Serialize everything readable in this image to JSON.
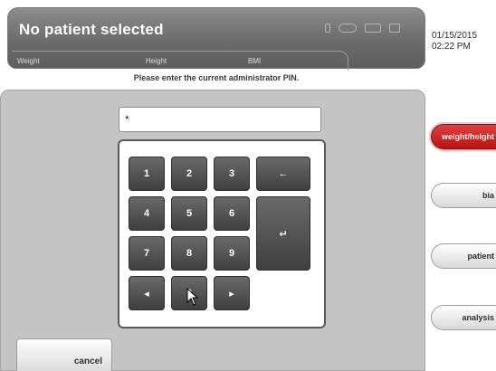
{
  "header": {
    "title": "No patient selected",
    "stats": [
      {
        "label": "Weight"
      },
      {
        "label": "Height"
      },
      {
        "label": "BMI"
      }
    ],
    "status_icons": [
      "battery-icon",
      "scale-icon",
      "transfer-icon",
      "network-icon"
    ]
  },
  "datetime": {
    "date": "01/15/2015",
    "time": "02:22 PM"
  },
  "prompt": "Please enter the current administrator PIN.",
  "pin_field": {
    "value": "*"
  },
  "keypad": {
    "keys": {
      "k1": "1",
      "k2": "2",
      "k3": "3",
      "k4": "4",
      "k5": "5",
      "k6": "6",
      "k7": "7",
      "k8": "8",
      "k9": "9",
      "k0": "0",
      "left": "◂",
      "right": "▸",
      "backspace": "←",
      "enter": "↵"
    }
  },
  "sidebar": {
    "tabs": [
      {
        "label": "weight/height",
        "active": true
      },
      {
        "label": "bia",
        "active": false
      },
      {
        "label": "patient",
        "active": false
      },
      {
        "label": "analysis",
        "active": false
      }
    ]
  },
  "footer": {
    "cancel_label": "cancel"
  },
  "colors": {
    "active_tab": "#c81e1e",
    "header": "#737373",
    "panel": "#c4c4c4",
    "key": "#4e4e4e"
  }
}
